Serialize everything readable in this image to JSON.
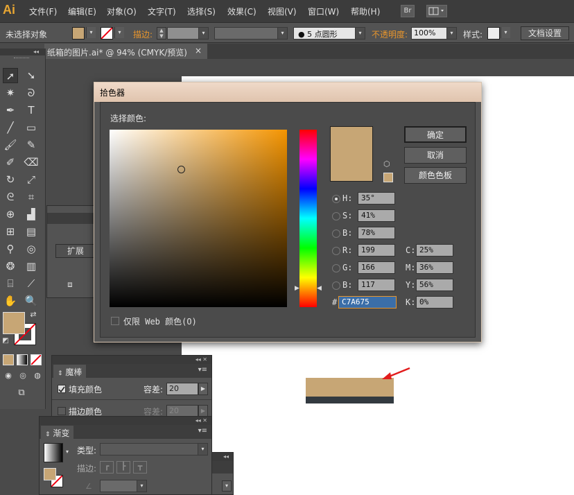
{
  "app": {
    "logo": "Ai"
  },
  "menu": [
    "文件(F)",
    "编辑(E)",
    "对象(O)",
    "文字(T)",
    "选择(S)",
    "效果(C)",
    "视图(V)",
    "窗口(W)",
    "帮助(H)"
  ],
  "menu_badge": "Br",
  "control": {
    "selection": "未选择对象",
    "stroke_label": "描边:",
    "brush": "5 点圆形",
    "opacity_label": "不透明度:",
    "opacity": "100%",
    "style_label": "样式:",
    "doc_setup": "文档设置"
  },
  "doc_tab": {
    "title": "纸箱的图片.ai* @ 94% (CMYK/预览)",
    "close": "×"
  },
  "partial_panel": {
    "expand": "扩展"
  },
  "magic_wand": {
    "tab": "魔棒",
    "fill_label": "填充颜色",
    "fill_checked": true,
    "tolerance_label": "容差:",
    "fill_tolerance": "20",
    "stroke_label": "描边颜色",
    "stroke_checked": false,
    "stroke_tolerance": "20"
  },
  "gradient": {
    "tab": "渐变",
    "type_label": "类型:",
    "stroke_label": "描边:"
  },
  "picker": {
    "title": "拾色器",
    "select_label": "选择颜色:",
    "ok": "确定",
    "cancel": "取消",
    "swatches": "颜色色板",
    "hsb": [
      {
        "label": "H:",
        "value": "35°",
        "selected": true
      },
      {
        "label": "S:",
        "value": "41%"
      },
      {
        "label": "B:",
        "value": "78%"
      }
    ],
    "rgb": [
      {
        "label": "R:",
        "value": "199"
      },
      {
        "label": "G:",
        "value": "166"
      },
      {
        "label": "B:",
        "value": "117"
      }
    ],
    "cmyk": [
      {
        "label": "C:",
        "value": "25%"
      },
      {
        "label": "M:",
        "value": "36%"
      },
      {
        "label": "Y:",
        "value": "56%"
      },
      {
        "label": "K:",
        "value": "0%"
      }
    ],
    "hex_label": "#",
    "hex": "C7A675",
    "web_only": "仅限 Web 颜色(O)"
  },
  "colors": {
    "current": "#c7a675",
    "accent": "#e9962c",
    "box_dark": "#333a40",
    "arrow": "#e21c1c"
  }
}
